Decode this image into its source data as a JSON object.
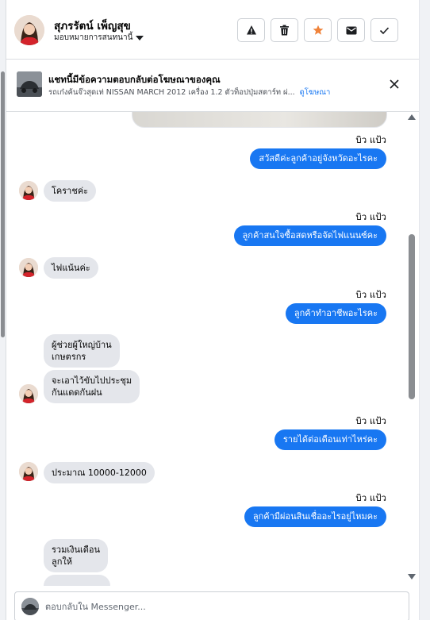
{
  "header": {
    "name": "สุภรรัตน์ เพ็ญสุข",
    "assign_label": "มอบหมายการสนทนานี้",
    "actions": [
      "warning-icon",
      "trash-icon",
      "star-icon",
      "envelope-icon",
      "check-icon"
    ],
    "accent_star": "#f0833a"
  },
  "ad": {
    "title": "แชทนี้มีข้อความตอบกลับต่อโฆษณาของคุณ",
    "subtitle": "รถเก๋งค้นจ๊วสุดเท่ NISSAN MARCH 2012 เครื่อง 1.2 ตัวท็อปปุ่มสตาร์ท ผ่...",
    "link": "ดูโฆษณา"
  },
  "messages": {
    "m1": {
      "sender": "บิว แป้ว",
      "text": "สวัสดีค่ะลูกค้าอยู่จังหวัดอะไรคะ"
    },
    "m2": {
      "text": "โคราชค่ะ"
    },
    "m3": {
      "sender": "บิว แป้ว",
      "text": "ลูกค้าสนใจซื้อสดหรือจัดไฟแนนซ์คะ"
    },
    "m4": {
      "text": "ไฟแน้นค่ะ"
    },
    "m5": {
      "sender": "บิว แป้ว",
      "text": "ลูกค้าทำอาชีพอะไรคะ"
    },
    "m6": {
      "line1": "ผู้ช่วยผู้ใหญ่บ้าน",
      "line2": "เกษตรกร"
    },
    "m7": {
      "line1": "จะเอาไว้ขับไปประชุม",
      "line2": "กันแดดกันฝน"
    },
    "m8": {
      "sender": "บิว แป้ว",
      "text": "รายได้ต่อเดือนเท่าไหร่คะ"
    },
    "m9": {
      "text": "ประมาณ   10000-12000"
    },
    "m10": {
      "sender": "บิว แป้ว",
      "text": "ลูกค้ามีผ่อนสินเชื่ออะไรอยู่ไหมคะ"
    },
    "m11": {
      "line1": "รวมเงินเดือน",
      "line2": "ลูกให้"
    }
  },
  "reply": {
    "placeholder": "ตอบกลับใน Messenger..."
  },
  "colors": {
    "outgoing": "#1877f2",
    "incoming": "#e4e6eb"
  }
}
